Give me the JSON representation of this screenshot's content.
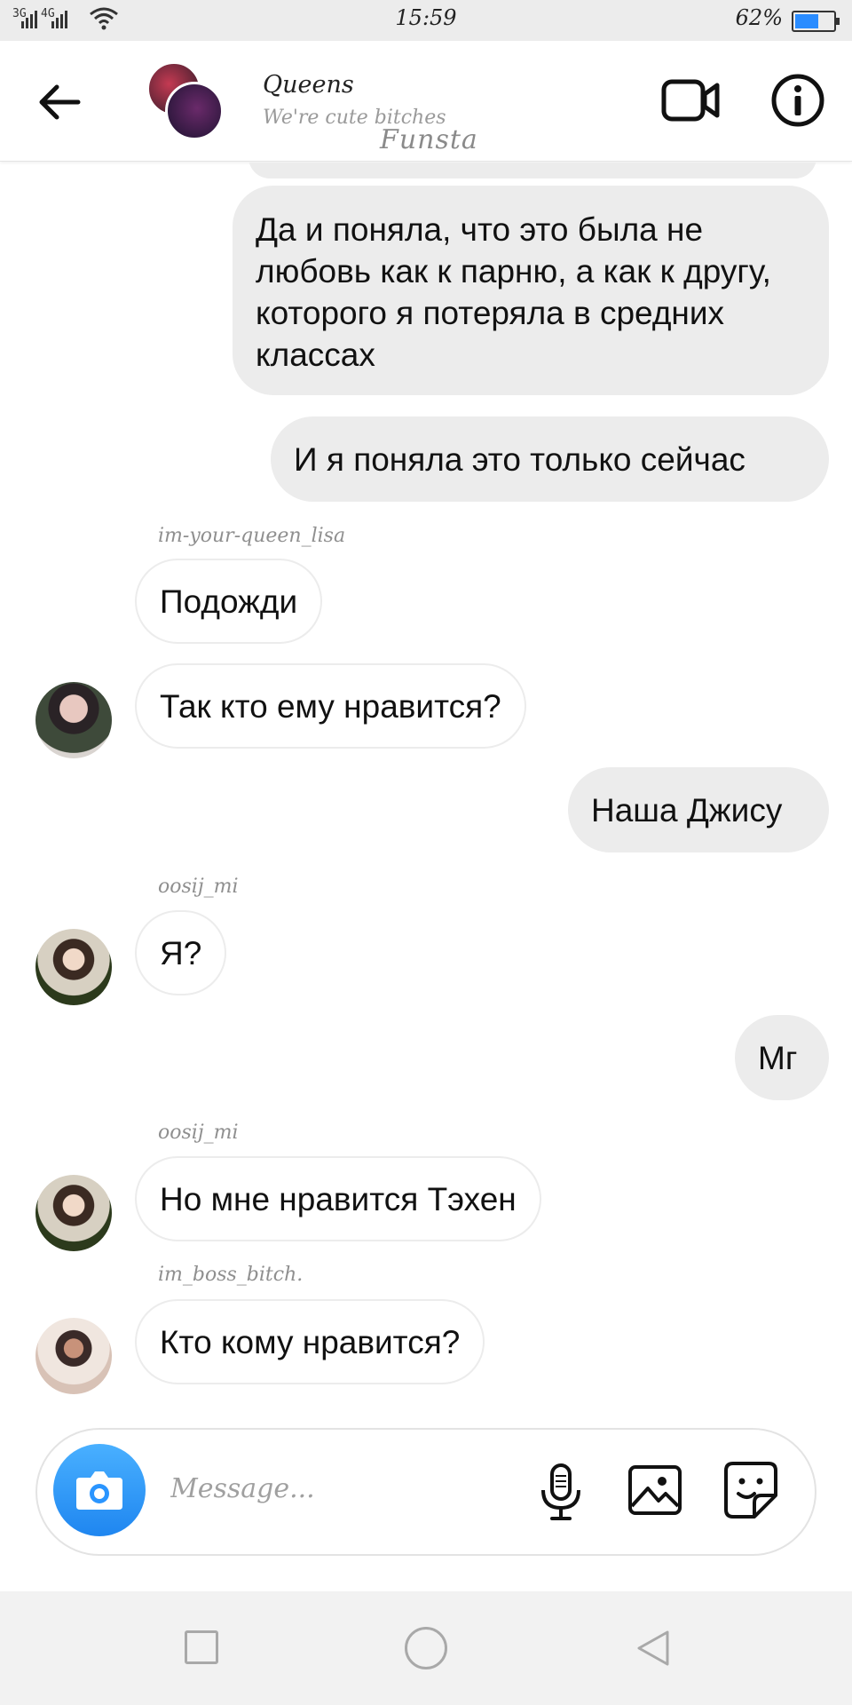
{
  "status_bar": {
    "network1": "3G",
    "network2": "4G",
    "time": "15:59",
    "battery_percent_text": "62%",
    "battery_level": 0.62
  },
  "header": {
    "title": "Queens",
    "subtitle": "We're cute bitches",
    "watermark": "Funsta",
    "icons": [
      "back-arrow-icon",
      "video-camera-icon",
      "info-icon"
    ]
  },
  "messages": [
    {
      "side": "out",
      "text": "Да и поняла, что это была не любовь как к парню, а как к другу, которого я потеряла в средних классах"
    },
    {
      "side": "out",
      "text": "И я поняла это только сейчас"
    },
    {
      "side": "in",
      "sender": "im-your-queen_lisa",
      "text": "Подожди"
    },
    {
      "side": "in",
      "text": "Так кто ему нравится?"
    },
    {
      "side": "out",
      "text": "Наша Джису"
    },
    {
      "side": "in",
      "sender": "oosij_mi",
      "text": "Я?"
    },
    {
      "side": "out",
      "text": "Мг"
    },
    {
      "side": "in",
      "sender": "oosij_mi",
      "text": "Но мне нравится Тэхен"
    },
    {
      "side": "in",
      "sender": "im_boss_bitch.",
      "text": "Кто кому нравится?"
    }
  ],
  "composer": {
    "placeholder": "Message...",
    "icons": [
      "camera-icon",
      "microphone-icon",
      "gallery-icon",
      "sticker-icon"
    ]
  },
  "nav_bar": {
    "icons": [
      "recent-apps-icon",
      "home-icon",
      "back-icon"
    ]
  },
  "colors": {
    "outgoing_bubble": "#ececec",
    "incoming_border": "#ececec",
    "camera_button": "#2a95ff",
    "battery_fill": "#2a8cff"
  }
}
